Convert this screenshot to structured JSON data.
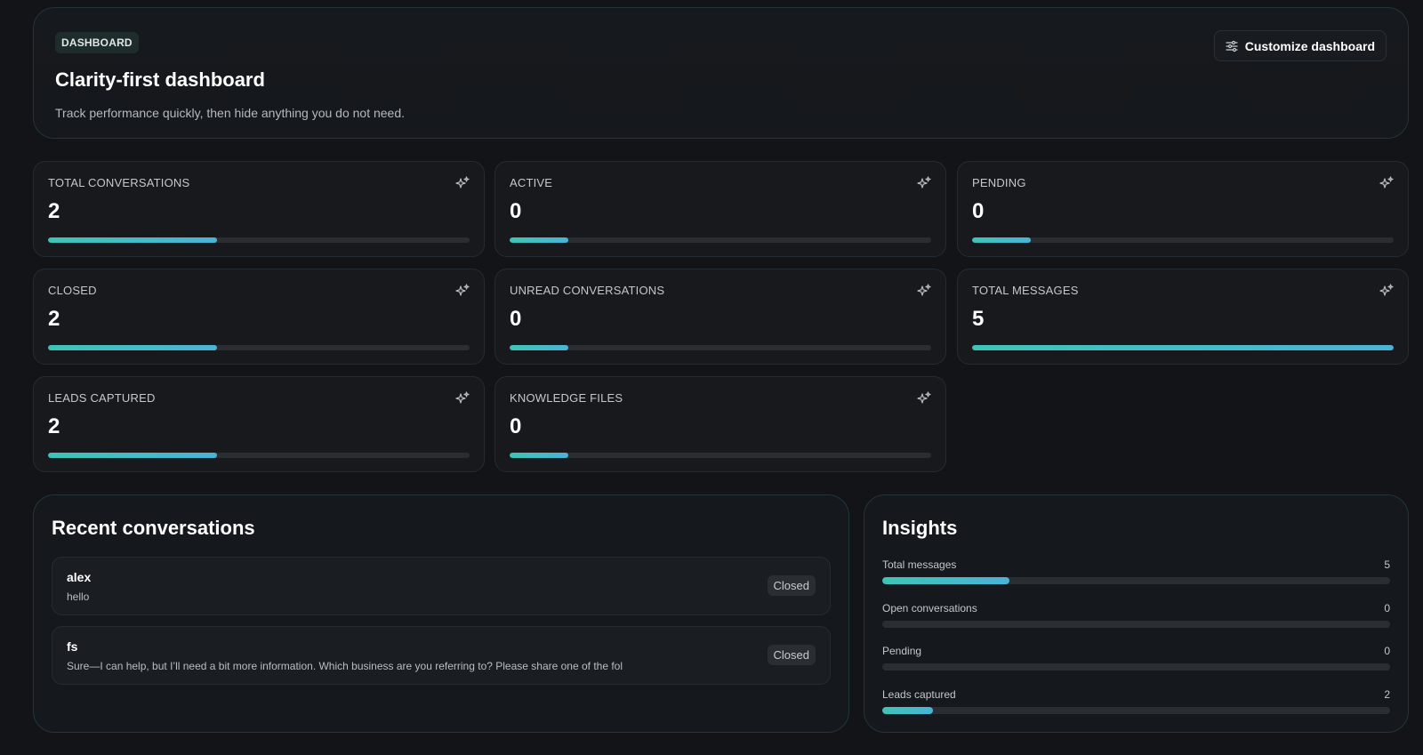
{
  "header": {
    "badge": "DASHBOARD",
    "title": "Clarity-first dashboard",
    "subtitle": "Track performance quickly, then hide anything you do not need.",
    "customize_label": "Customize dashboard",
    "customize_icon": "sliders-icon"
  },
  "stats": [
    {
      "label": "TOTAL CONVERSATIONS",
      "value": "2",
      "progress": 0.4,
      "icon": "sparkle-icon"
    },
    {
      "label": "ACTIVE",
      "value": "0",
      "progress": 0.14,
      "icon": "sparkle-icon"
    },
    {
      "label": "PENDING",
      "value": "0",
      "progress": 0.14,
      "icon": "sparkle-icon"
    },
    {
      "label": "CLOSED",
      "value": "2",
      "progress": 0.4,
      "icon": "sparkle-icon"
    },
    {
      "label": "UNREAD CONVERSATIONS",
      "value": "0",
      "progress": 0.14,
      "icon": "sparkle-icon"
    },
    {
      "label": "TOTAL MESSAGES",
      "value": "5",
      "progress": 1.0,
      "icon": "sparkle-icon"
    },
    {
      "label": "LEADS CAPTURED",
      "value": "2",
      "progress": 0.4,
      "icon": "sparkle-icon"
    },
    {
      "label": "KNOWLEDGE FILES",
      "value": "0",
      "progress": 0.14,
      "icon": "sparkle-icon"
    }
  ],
  "recent": {
    "title": "Recent conversations",
    "items": [
      {
        "name": "alex",
        "preview": "hello",
        "status": "Closed"
      },
      {
        "name": "fs",
        "preview": "Sure—I can help, but I’ll need a bit more information. Which business are you referring to? Please share one of the fol",
        "status": "Closed"
      }
    ]
  },
  "insights": {
    "title": "Insights",
    "items": [
      {
        "label": "Total messages",
        "value": "5",
        "progress": 0.25
      },
      {
        "label": "Open conversations",
        "value": "0",
        "progress": 0
      },
      {
        "label": "Pending",
        "value": "0",
        "progress": 0
      },
      {
        "label": "Leads captured",
        "value": "2",
        "progress": 0.1
      }
    ]
  },
  "colors": {
    "accent_start": "#3ec4b6",
    "accent_end": "#4ab3d6",
    "background": "#121418",
    "card": "#17191d"
  }
}
